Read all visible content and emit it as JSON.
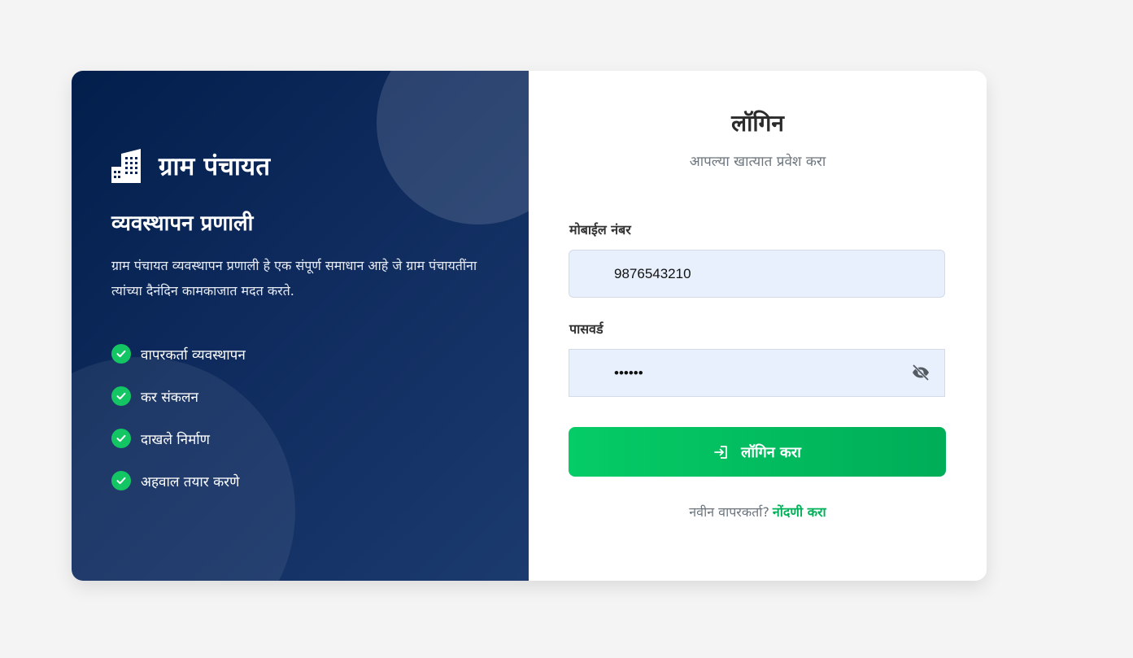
{
  "brand": {
    "title": "ग्राम पंचायत",
    "subtitle": "व्यवस्थापन प्रणाली",
    "description": "ग्राम पंचायत व्यवस्थापन प्रणाली हे एक संपूर्ण समाधान आहे जे ग्राम पंचायतींना त्यांच्या दैनंदिन कामकाजात मदत करते.",
    "icon": "building-icon"
  },
  "features": [
    {
      "label": "वापरकर्ता व्यवस्थापन",
      "icon": "check-circle-icon"
    },
    {
      "label": "कर संकलन",
      "icon": "check-circle-icon"
    },
    {
      "label": "दाखले निर्माण",
      "icon": "check-circle-icon"
    },
    {
      "label": "अहवाल तयार करणे",
      "icon": "check-circle-icon"
    }
  ],
  "login": {
    "title": "लॉगिन",
    "subtitle": "आपल्या खात्यात प्रवेश करा",
    "mobile_label": "मोबाईल नंबर",
    "mobile_value": "9876543210",
    "password_label": "पासवर्ड",
    "password_value": "••••••",
    "submit_label": "लॉगिन करा",
    "register_prompt": "नवीन वापरकर्ता?",
    "register_link": "नोंदणी करा"
  },
  "colors": {
    "panel_dark": "#021e4b",
    "accent_green": "#05cc66",
    "input_bg": "#e8f0fe"
  }
}
